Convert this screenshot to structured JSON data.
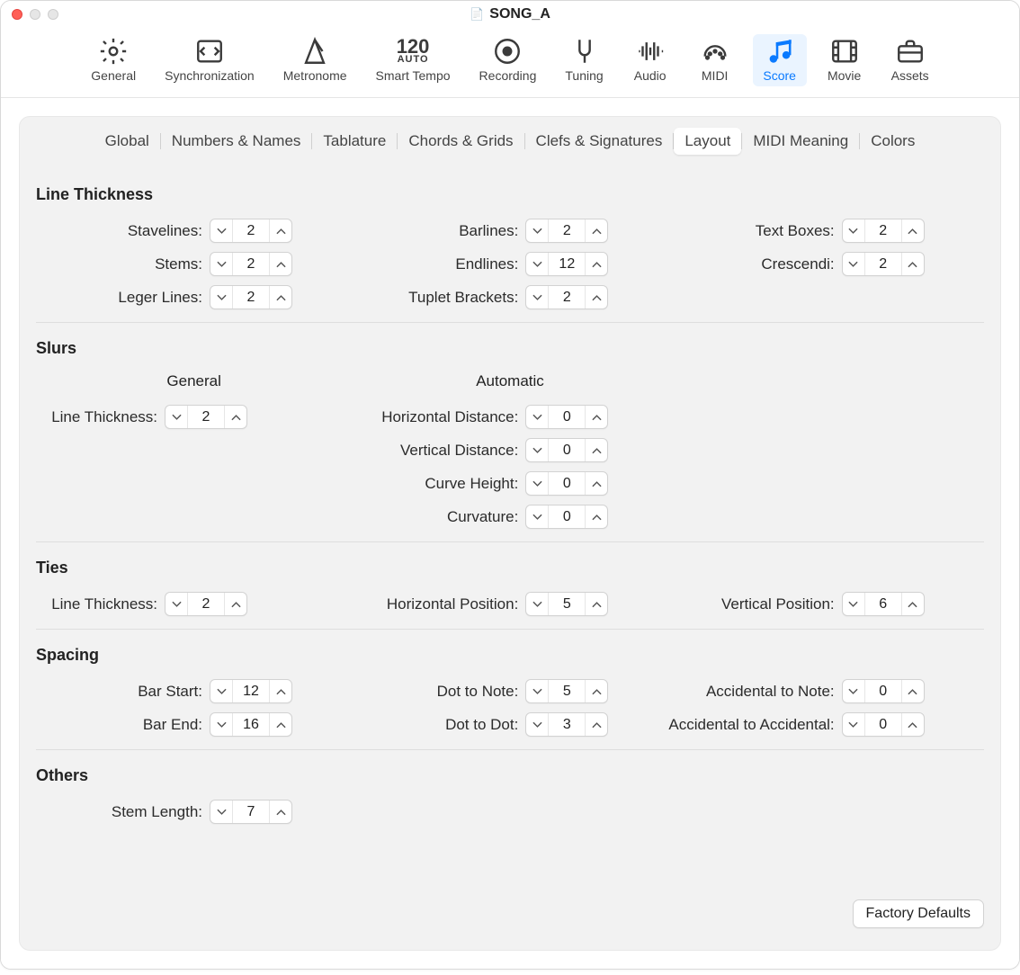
{
  "window": {
    "title": "SONG_A"
  },
  "toolbar": [
    {
      "id": "general",
      "label": "General",
      "icon": "gear-icon"
    },
    {
      "id": "sync",
      "label": "Synchronization",
      "icon": "sync-icon"
    },
    {
      "id": "metronome",
      "label": "Metronome",
      "icon": "metronome-icon"
    },
    {
      "id": "smarttempo",
      "label": "Smart Tempo",
      "icon": "smart-tempo-icon"
    },
    {
      "id": "recording",
      "label": "Recording",
      "icon": "record-icon"
    },
    {
      "id": "tuning",
      "label": "Tuning",
      "icon": "tuning-fork-icon"
    },
    {
      "id": "audio",
      "label": "Audio",
      "icon": "waveform-icon"
    },
    {
      "id": "midi",
      "label": "MIDI",
      "icon": "midi-icon"
    },
    {
      "id": "score",
      "label": "Score",
      "icon": "score-icon",
      "active": true
    },
    {
      "id": "movie",
      "label": "Movie",
      "icon": "film-icon"
    },
    {
      "id": "assets",
      "label": "Assets",
      "icon": "briefcase-icon"
    }
  ],
  "smart_tempo_top": "120",
  "smart_tempo_sub": "AUTO",
  "subtabs": [
    "Global",
    "Numbers & Names",
    "Tablature",
    "Chords & Grids",
    "Clefs & Signatures",
    "Layout",
    "MIDI Meaning",
    "Colors"
  ],
  "subtab_active": "Layout",
  "line_thickness": {
    "title": "Line Thickness",
    "col1": [
      {
        "label": "Stavelines:",
        "value": "2"
      },
      {
        "label": "Stems:",
        "value": "2"
      },
      {
        "label": "Leger Lines:",
        "value": "2"
      }
    ],
    "col2": [
      {
        "label": "Barlines:",
        "value": "2"
      },
      {
        "label": "Endlines:",
        "value": "12"
      },
      {
        "label": "Tuplet Brackets:",
        "value": "2"
      }
    ],
    "col3": [
      {
        "label": "Text Boxes:",
        "value": "2"
      },
      {
        "label": "Crescendi:",
        "value": "2"
      }
    ]
  },
  "slurs": {
    "title": "Slurs",
    "header_general": "General",
    "header_auto": "Automatic",
    "general": [
      {
        "label": "Line Thickness:",
        "value": "2"
      }
    ],
    "auto": [
      {
        "label": "Horizontal Distance:",
        "value": "0"
      },
      {
        "label": "Vertical Distance:",
        "value": "0"
      },
      {
        "label": "Curve Height:",
        "value": "0"
      },
      {
        "label": "Curvature:",
        "value": "0"
      }
    ]
  },
  "ties": {
    "title": "Ties",
    "col1": [
      {
        "label": "Line Thickness:",
        "value": "2"
      }
    ],
    "col2": [
      {
        "label": "Horizontal Position:",
        "value": "5"
      }
    ],
    "col3": [
      {
        "label": "Vertical Position:",
        "value": "6"
      }
    ]
  },
  "spacing": {
    "title": "Spacing",
    "col1": [
      {
        "label": "Bar Start:",
        "value": "12"
      },
      {
        "label": "Bar End:",
        "value": "16"
      }
    ],
    "col2": [
      {
        "label": "Dot to Note:",
        "value": "5"
      },
      {
        "label": "Dot to Dot:",
        "value": "3"
      }
    ],
    "col3": [
      {
        "label": "Accidental to Note:",
        "value": "0"
      },
      {
        "label": "Accidental to Accidental:",
        "value": "0"
      }
    ]
  },
  "others": {
    "title": "Others",
    "col1": [
      {
        "label": "Stem Length:",
        "value": "7"
      }
    ]
  },
  "factory_defaults": "Factory Defaults"
}
